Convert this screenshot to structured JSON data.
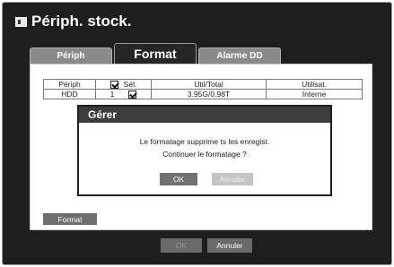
{
  "window": {
    "title": "Périph. stock."
  },
  "icons": {
    "title": "storage-device-icon"
  },
  "tabs": [
    {
      "label": "Périph",
      "active": false
    },
    {
      "label": "Format",
      "active": true
    },
    {
      "label": "Alarme DD",
      "active": false
    }
  ],
  "table": {
    "headers": {
      "device": "Périph",
      "select": "Sél.",
      "used_total": "Util/Total",
      "usage": "Utilisat."
    },
    "rows": [
      {
        "device": "HDD",
        "select": "1",
        "checked": true,
        "used_total": "3.95G/0.98T",
        "usage": "Interne"
      }
    ]
  },
  "dialog": {
    "title": "Gérer",
    "message_line1": "Le formatage supprime ts les enregist.",
    "message_line2": "Continuer le formatage ?",
    "ok_label": "OK",
    "cancel_label": "Annuler"
  },
  "panel": {
    "format_label": "Format"
  },
  "footer": {
    "ok_label": "OK",
    "cancel_label": "Annuler"
  }
}
